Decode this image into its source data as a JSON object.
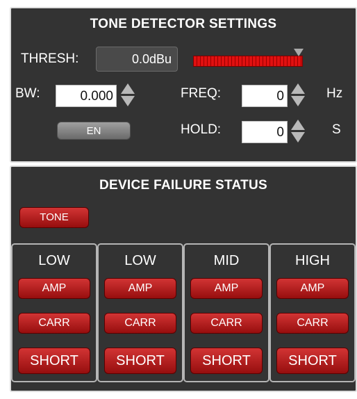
{
  "tone_detector": {
    "title": "TONE DETECTOR SETTINGS",
    "thresh_label": "THRESH:",
    "thresh_value": "0.0dBu",
    "bw_label": "BW:",
    "bw_value": "0.000",
    "freq_label": "FREQ:",
    "freq_value": "0",
    "freq_unit": "Hz",
    "hold_label": "HOLD:",
    "hold_value": "0",
    "hold_unit": "S",
    "enable_label": "EN"
  },
  "device_failure": {
    "title": "DEVICE FAILURE STATUS",
    "tone_label": "TONE",
    "columns": [
      {
        "band": "LOW",
        "amp": "AMP",
        "carr": "CARR",
        "short": "SHORT"
      },
      {
        "band": "LOW",
        "amp": "AMP",
        "carr": "CARR",
        "short": "SHORT"
      },
      {
        "band": "MID",
        "amp": "AMP",
        "carr": "CARR",
        "short": "SHORT"
      },
      {
        "band": "HIGH",
        "amp": "AMP",
        "carr": "CARR",
        "short": "SHORT"
      }
    ]
  },
  "colors": {
    "panel_bg": "#333333",
    "alarm_red": "#c21f1f",
    "meter_red": "#e01010"
  }
}
